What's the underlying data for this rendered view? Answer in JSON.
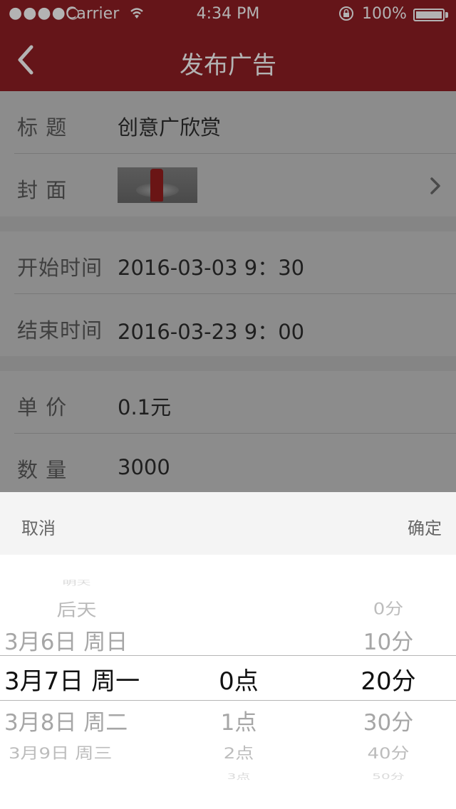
{
  "status_bar": {
    "signal": "●●●●○",
    "carrier": "Carrier",
    "time": "4:34 PM",
    "battery": "100%"
  },
  "nav": {
    "back_icon": "chevron-left-icon",
    "title": "发布广告"
  },
  "form": {
    "title_label": "标  题",
    "title_value": "创意广欣赏",
    "cover_label": "封  面",
    "start_label": "开始时间",
    "start_value": "2016-03-03  9：30",
    "end_label": "结束时间",
    "end_value": "2016-03-23  9：00",
    "price_label": "单  价",
    "price_value": "0.1元",
    "qty_label": "数  量",
    "qty_value": "3000"
  },
  "picker_toolbar": {
    "cancel_label": "取消",
    "confirm_label": "确定"
  },
  "picker": {
    "day_column": [
      "明天",
      "后天",
      "3月6日 周日",
      "3月7日 周一",
      "3月8日 周二",
      "3月9日 周三"
    ],
    "hour_column": [
      "0点",
      "1点",
      "2点",
      "3点"
    ],
    "minute_column": [
      "0分",
      "10分",
      "20分",
      "30分",
      "40分",
      "50分"
    ],
    "selected": {
      "day": "3月7日 周一",
      "hour": "0点",
      "minute": "20分"
    }
  },
  "colors": {
    "nav_bg_dimmed": "#651519",
    "form_bg_dimmed": "#8c8c8c",
    "toolbar_bg": "#f4f4f4",
    "picker_bg": "#ffffff"
  }
}
